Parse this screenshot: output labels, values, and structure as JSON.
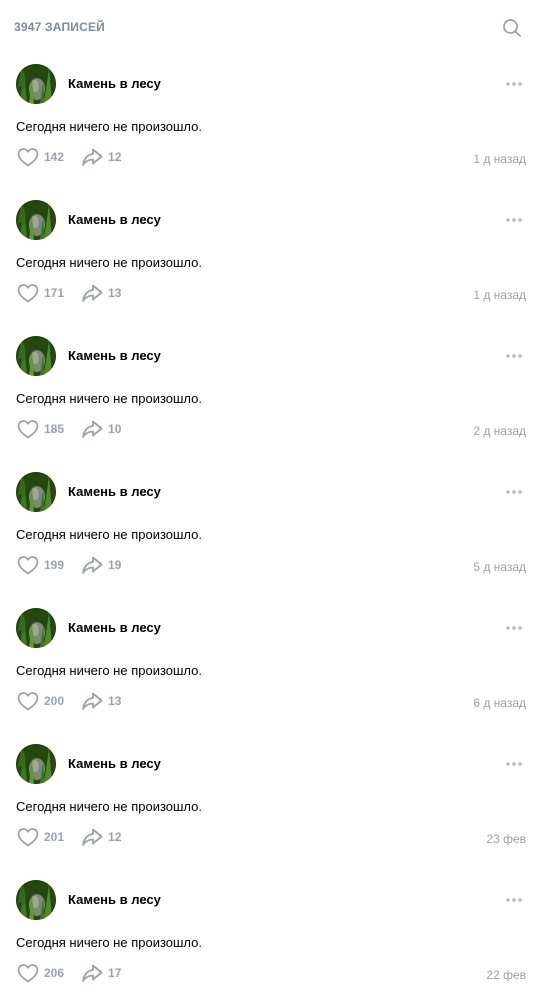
{
  "header": {
    "count_label": "3947 записей"
  },
  "colors": {
    "secondary_text": "#818c99",
    "icon_gray": "#99a2ad",
    "avatar_green": "#2f5a1e"
  },
  "icons": {
    "search": "search-icon",
    "more": "more-icon",
    "like": "heart-icon",
    "share": "share-icon"
  },
  "posts": [
    {
      "author": "Камень в лесу",
      "text": "Сегодня ничего не произошло.",
      "likes": "142",
      "shares": "12",
      "time": "1 д назад"
    },
    {
      "author": "Камень в лесу",
      "text": "Сегодня ничего не произошло.",
      "likes": "171",
      "shares": "13",
      "time": "1 д назад"
    },
    {
      "author": "Камень в лесу",
      "text": "Сегодня ничего не произошло.",
      "likes": "185",
      "shares": "10",
      "time": "2 д назад"
    },
    {
      "author": "Камень в лесу",
      "text": "Сегодня ничего не произошло.",
      "likes": "199",
      "shares": "19",
      "time": "5 д назад"
    },
    {
      "author": "Камень в лесу",
      "text": "Сегодня ничего не произошло.",
      "likes": "200",
      "shares": "13",
      "time": "6 д назад"
    },
    {
      "author": "Камень в лесу",
      "text": "Сегодня ничего не произошло.",
      "likes": "201",
      "shares": "12",
      "time": "23 фев"
    },
    {
      "author": "Камень в лесу",
      "text": "Сегодня ничего не произошло.",
      "likes": "206",
      "shares": "17",
      "time": "22 фев"
    }
  ]
}
